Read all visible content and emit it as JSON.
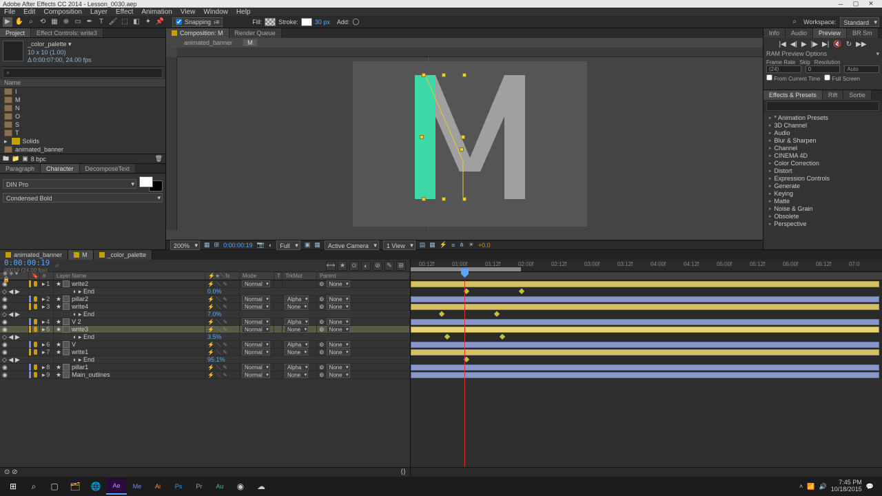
{
  "titlebar": {
    "title": "Adobe After Effects CC 2014 - Lesson_0030.aep"
  },
  "menu": [
    "File",
    "Edit",
    "Composition",
    "Layer",
    "Effect",
    "Animation",
    "View",
    "Window",
    "Help"
  ],
  "toolbar": {
    "snapping": "Snapping",
    "fill_label": "Fill:",
    "stroke_label": "Stroke:",
    "stroke_px": "30 px",
    "add_label": "Add:",
    "workspace_label": "Workspace:",
    "workspace_value": "Standard"
  },
  "project": {
    "tabs": [
      "Project",
      "Effect Controls: write3"
    ],
    "item_name": "_color_palette ▾",
    "meta1": "10 x 10 (1.00)",
    "meta2": "Δ 0:00:07:00, 24.00 fps",
    "search_placeholder": "⌕",
    "cols": [
      "Name"
    ],
    "items": [
      {
        "type": "comp",
        "label": "I"
      },
      {
        "type": "comp",
        "label": "M"
      },
      {
        "type": "comp",
        "label": "N"
      },
      {
        "type": "comp",
        "label": "O"
      },
      {
        "type": "comp",
        "label": "S"
      },
      {
        "type": "comp",
        "label": "T"
      },
      {
        "type": "folder",
        "label": "Solids"
      },
      {
        "type": "comp",
        "label": "animated_banner"
      }
    ],
    "footer_bpc": "8 bpc"
  },
  "char": {
    "tabs": [
      "Paragraph",
      "Character",
      "DecomposeText"
    ],
    "font": "DIN Pro",
    "weight": "Condensed Bold"
  },
  "comp": {
    "tabs": [
      "Composition: M",
      "Render Queue"
    ],
    "subtabs": [
      "animated_banner",
      "M"
    ],
    "active_subtab": 1
  },
  "viewer_footer": {
    "zoom": "200%",
    "timecode": "0:00:00:19",
    "res": "Full",
    "camera": "Active Camera",
    "views": "1 View",
    "exposure": "+0.0"
  },
  "right_panel": {
    "tabs": [
      "Info",
      "Audio",
      "Preview",
      "BR Sm"
    ],
    "ram_title": "RAM Preview Options",
    "labels": [
      "Frame Rate",
      "Skip",
      "Resolution"
    ],
    "vals": [
      "(24)",
      "0",
      "Auto"
    ],
    "from_current": "From Current Time",
    "full_screen": "Full Screen"
  },
  "effects_presets": {
    "tabs": [
      "Effects & Presets",
      "Rift",
      "Sortie"
    ],
    "items": [
      "* Animation Presets",
      "3D Channel",
      "Audio",
      "Blur & Sharpen",
      "Channel",
      "CINEMA 4D",
      "Color Correction",
      "Distort",
      "Expression Controls",
      "Generate",
      "Keying",
      "Matte",
      "Noise & Grain",
      "Obsolete",
      "Perspective"
    ]
  },
  "timeline": {
    "tabs": [
      {
        "label": "animated_banner",
        "active": false
      },
      {
        "label": "M",
        "active": true
      },
      {
        "label": "_color_palette",
        "active": false
      }
    ],
    "timecode": "0:00:00:19",
    "timecode_sub": "00019 (24.00 fps)",
    "cols": [
      "",
      "",
      "",
      "#",
      "Layer Name",
      "",
      "⚡",
      "Mode",
      "T",
      "TrkMat",
      "Parent"
    ],
    "ruler_ticks": [
      "00:12f",
      "01:00f",
      "01:12f",
      "02:00f",
      "02:12f",
      "03:00f",
      "03:12f",
      "04:00f",
      "04:12f",
      "05:00f",
      "05:12f",
      "06:00f",
      "06:12f",
      "07:0"
    ],
    "layers": [
      {
        "num": 1,
        "color": "yellow",
        "name": "write2",
        "mode": "Normal",
        "trkmat": "",
        "parent": "None",
        "bar": "yellow"
      },
      {
        "prop": true,
        "name": "End",
        "value": "0.0%",
        "kfs": [
          78,
          158
        ]
      },
      {
        "num": 2,
        "color": "blue",
        "name": "pillar2",
        "mode": "Normal",
        "trkmat": "Alpha",
        "parent": "None",
        "bar": "blue"
      },
      {
        "num": 3,
        "color": "yellow",
        "name": "write4",
        "mode": "Normal",
        "trkmat": "None",
        "parent": "None",
        "bar": "yellow"
      },
      {
        "prop": true,
        "name": "End",
        "value": "7.0%",
        "kfs": [
          42,
          122
        ]
      },
      {
        "num": 4,
        "color": "blue",
        "name": "V 2",
        "mode": "Normal",
        "trkmat": "Alpha",
        "parent": "None",
        "bar": "blue"
      },
      {
        "num": 5,
        "color": "yellow",
        "name": "write3",
        "mode": "Normal",
        "trkmat": "None",
        "parent": "None",
        "bar": "yellow",
        "selected": true
      },
      {
        "prop": true,
        "name": "End",
        "value": "3.5%",
        "kfs": [
          50,
          130
        ],
        "selected": true
      },
      {
        "num": 6,
        "color": "blue",
        "name": "V",
        "mode": "Normal",
        "trkmat": "Alpha",
        "parent": "None",
        "bar": "blue"
      },
      {
        "num": 7,
        "color": "yellow",
        "name": "write1",
        "mode": "Normal",
        "trkmat": "None",
        "parent": "None",
        "bar": "yellow"
      },
      {
        "prop": true,
        "name": "End",
        "value": "95.1%",
        "kfs": [
          78
        ]
      },
      {
        "num": 8,
        "color": "blue",
        "name": "pillar1",
        "mode": "Normal",
        "trkmat": "Alpha",
        "parent": "None",
        "bar": "blue"
      },
      {
        "num": 9,
        "color": "blue",
        "name": "Main_outlines",
        "mode": "Normal",
        "trkmat": "None",
        "parent": "None",
        "bar": "blue"
      }
    ]
  },
  "taskbar": {
    "time": "7:45 PM",
    "date": "10/18/2015"
  }
}
